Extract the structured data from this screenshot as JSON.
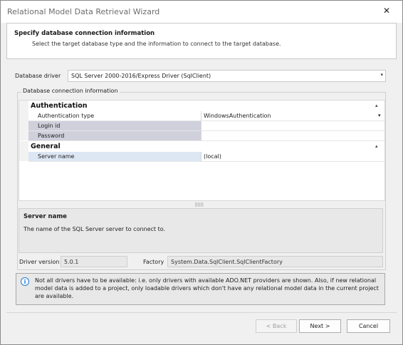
{
  "window": {
    "title": "Relational Model Data Retrieval Wizard",
    "close_glyph": "✕"
  },
  "header": {
    "title": "Specify database connection information",
    "subtitle": "Select the target database type and the information to connect to the target database."
  },
  "driver": {
    "label": "Database driver",
    "value": "SQL Server 2000-2016/Express Driver (SqlClient)",
    "arrow": "▾"
  },
  "connection": {
    "group_title": "Database connection information",
    "categories": [
      {
        "name": "Authentication",
        "rows": [
          {
            "name": "Authentication type",
            "value": "WindowsAuthentication"
          },
          {
            "name": "Login id",
            "value": ""
          },
          {
            "name": "Password",
            "value": ""
          }
        ]
      },
      {
        "name": "General",
        "rows": [
          {
            "name": "Server name",
            "value": "(local)"
          }
        ]
      }
    ],
    "collapse_glyph": "▴",
    "value_arrow": "▾",
    "splitter": "⠿⠿⠿"
  },
  "description": {
    "title": "Server name",
    "text": "The name of the SQL Server server to connect to."
  },
  "footer_fields": {
    "driver_version_label": "Driver version",
    "driver_version": "5.0.1",
    "factory_label": "Factory",
    "factory": "System.Data.SqlClient.SqlClientFactory"
  },
  "info": {
    "icon": "i",
    "text": "Not all drivers have to be available: i.e. only drivers with available ADO.NET providers are shown. Also, if new relational model data is added to a project, only loadable drivers which don't have any relational model data in the current project are available."
  },
  "buttons": {
    "back": "< Back",
    "next": "Next >",
    "cancel": "Cancel"
  }
}
